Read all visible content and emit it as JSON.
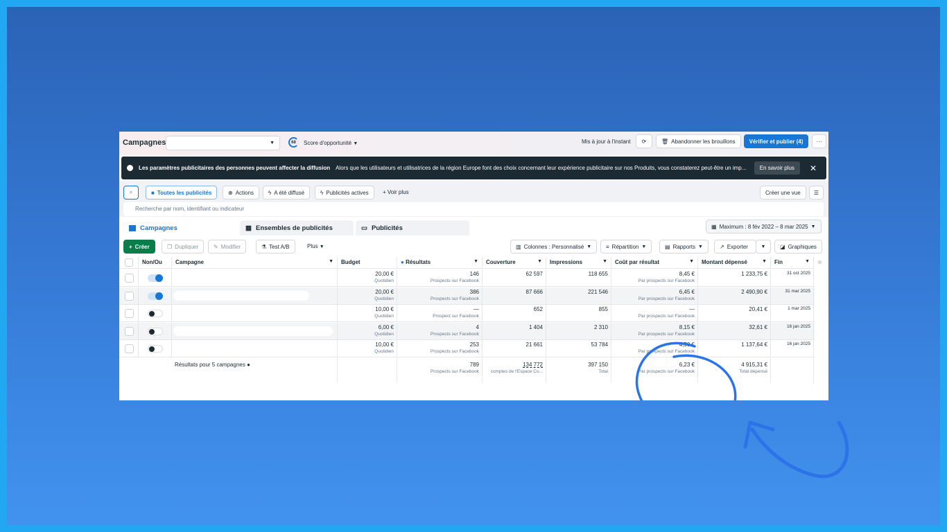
{
  "header": {
    "title": "Campagnes",
    "score_value": "68",
    "score_label": "Score d'opportunité",
    "updated": "Mis à jour à l'instant",
    "discard": "Abandonner les brouillons",
    "publish": "Vérifier et publier (4)",
    "more": "···"
  },
  "banner": {
    "title": "Les paramètres publicitaires des personnes peuvent affecter la diffusion",
    "text": "Alors que les utilisateurs et utilisatrices de la région Europe font des choix concernant leur expérience publicitaire sur nos Produits, vous constaterez peut-être un imp...",
    "learn_more": "En savoir plus"
  },
  "filters": {
    "items": [
      "Toutes les publicités",
      "Actions",
      "A été diffusé",
      "Publicités actives",
      "Voir plus"
    ],
    "create_view": "Créer une vue",
    "search_placeholder": "Recherche par nom, identifiant ou indicateur"
  },
  "tabs": [
    "Campagnes",
    "Ensembles de publicités",
    "Publicités"
  ],
  "date_range": "Maximum : 8 fév 2022 – 8 mar 2025",
  "toolbar": {
    "create": "Créer",
    "duplicate": "Dupliquer",
    "edit": "Modifier",
    "ab_test": "Test A/B",
    "more": "Plus",
    "columns": "Colonnes : Personnalisé",
    "breakdown": "Répartition",
    "reports": "Rapports",
    "export": "Exporter",
    "charts": "Graphiques"
  },
  "columns": [
    "Non/Ou",
    "Campagne",
    "Budget",
    "Résultats",
    "Couverture",
    "Impressions",
    "Coût par résultat",
    "Montant dépensé",
    "Fin"
  ],
  "rows": [
    {
      "on": true,
      "budget": "20,00 €",
      "budget_type": "Quotidien",
      "results": "146",
      "results_type": "Prospects sur Facebook",
      "reach": "62 597",
      "impressions": "118 655",
      "cpr": "8,45 €",
      "cpr_type": "Par prospects sur Facebook",
      "spent": "1 233,75 €",
      "end": "31 oct 2025"
    },
    {
      "on": true,
      "budget": "20,00 €",
      "budget_type": "Quotidien",
      "results": "386",
      "results_type": "Prospects sur Facebook",
      "reach": "87 666",
      "impressions": "221 546",
      "cpr": "6,45 €",
      "cpr_type": "Par prospects sur Facebook",
      "spent": "2 490,90 €",
      "end": "31 mar 2025"
    },
    {
      "on": false,
      "budget": "10,00 €",
      "budget_type": "Quotidien",
      "results": "—",
      "results_type": "Prospect sur Facebook",
      "reach": "652",
      "impressions": "855",
      "cpr": "—",
      "cpr_type": "Par prospects sur Facebook",
      "spent": "20,41 €",
      "end": "1 mar 2025"
    },
    {
      "on": false,
      "budget": "6,00 €",
      "budget_type": "Quotidien",
      "results": "4",
      "results_type": "Prospects sur Facebook",
      "reach": "1 404",
      "impressions": "2 310",
      "cpr": "8,15 €",
      "cpr_type": "Par prospects sur Facebook",
      "spent": "32,61 €",
      "end": "16 jan 2025"
    },
    {
      "on": false,
      "budget": "10,00 €",
      "budget_type": "Quotidien",
      "results": "253",
      "results_type": "Prospects sur Facebook",
      "reach": "21 661",
      "impressions": "53 784",
      "cpr": "4,50 €",
      "cpr_type": "Par prospects sur Facebook",
      "spent": "1 137,64 €",
      "end": "16 jan 2025"
    }
  ],
  "totals": {
    "label": "Résultats pour 5 campagnes",
    "results": "789",
    "results_type": "Prospects sur Facebook",
    "reach": "134 772",
    "reach_type": "comptes de l'Espace Co...",
    "impressions": "397 150",
    "impressions_type": "Total",
    "cpr": "6,23 €",
    "cpr_type": "Par prospects sur Facebook",
    "spent": "4 915,31 €",
    "spent_type": "Total dépensé"
  },
  "colors": {
    "accent": "#1877d3",
    "create": "#0a7d4b",
    "annotation": "#2b73e8"
  }
}
